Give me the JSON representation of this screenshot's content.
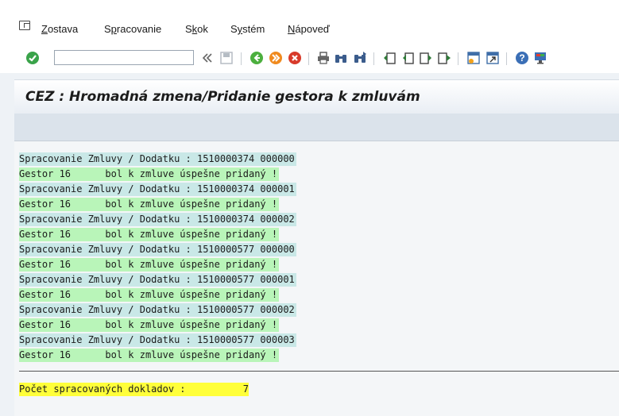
{
  "menu": {
    "items": [
      {
        "label": "Zostava",
        "access": "Z"
      },
      {
        "label": "Spracovanie",
        "access": "p"
      },
      {
        "label": "Skok",
        "access": "k"
      },
      {
        "label": "Systém",
        "access": "y"
      },
      {
        "label": "Nápoveď",
        "access": "N"
      }
    ]
  },
  "toolbar": {
    "command_field": {
      "value": "",
      "placeholder": ""
    },
    "icons": [
      "enter-check-icon",
      "command-dropdown-icon",
      "collapse-icon",
      "save-icon",
      "back-icon",
      "exit-icon",
      "cancel-icon",
      "print-icon",
      "find-icon",
      "find-next-icon",
      "first-page-icon",
      "previous-page-icon",
      "next-page-icon",
      "last-page-icon",
      "create-session-icon",
      "generate-shortcut-icon",
      "help-icon",
      "customize-layout-icon"
    ]
  },
  "title": "CEZ : Hromadná zmena/Pridanie gestora k zmluvám",
  "output": {
    "lines": [
      {
        "type": "proc",
        "text": "Spracovanie Zmluvy / Dodatku : 1510000374 000000"
      },
      {
        "type": "ok",
        "text": "Gestor 16      bol k zmluve úspešne pridaný !"
      },
      {
        "type": "proc",
        "text": "Spracovanie Zmluvy / Dodatku : 1510000374 000001"
      },
      {
        "type": "ok",
        "text": "Gestor 16      bol k zmluve úspešne pridaný !"
      },
      {
        "type": "proc",
        "text": "Spracovanie Zmluvy / Dodatku : 1510000374 000002"
      },
      {
        "type": "ok",
        "text": "Gestor 16      bol k zmluve úspešne pridaný !"
      },
      {
        "type": "proc",
        "text": "Spracovanie Zmluvy / Dodatku : 1510000577 000000"
      },
      {
        "type": "ok",
        "text": "Gestor 16      bol k zmluve úspešne pridaný !"
      },
      {
        "type": "proc",
        "text": "Spracovanie Zmluvy / Dodatku : 1510000577 000001"
      },
      {
        "type": "ok",
        "text": "Gestor 16      bol k zmluve úspešne pridaný !"
      },
      {
        "type": "proc",
        "text": "Spracovanie Zmluvy / Dodatku : 1510000577 000002"
      },
      {
        "type": "ok",
        "text": "Gestor 16      bol k zmluve úspešne pridaný !"
      },
      {
        "type": "proc",
        "text": "Spracovanie Zmluvy / Dodatku : 1510000577 000003"
      },
      {
        "type": "ok",
        "text": "Gestor 16      bol k zmluve úspešne pridaný !"
      }
    ],
    "total_label": "Počet spracovaných dokladov :",
    "total_value": "7"
  },
  "colors": {
    "proc_row": "#c9e8e7",
    "ok_row": "#b9f5b9",
    "total_row": "#ffff3a"
  }
}
